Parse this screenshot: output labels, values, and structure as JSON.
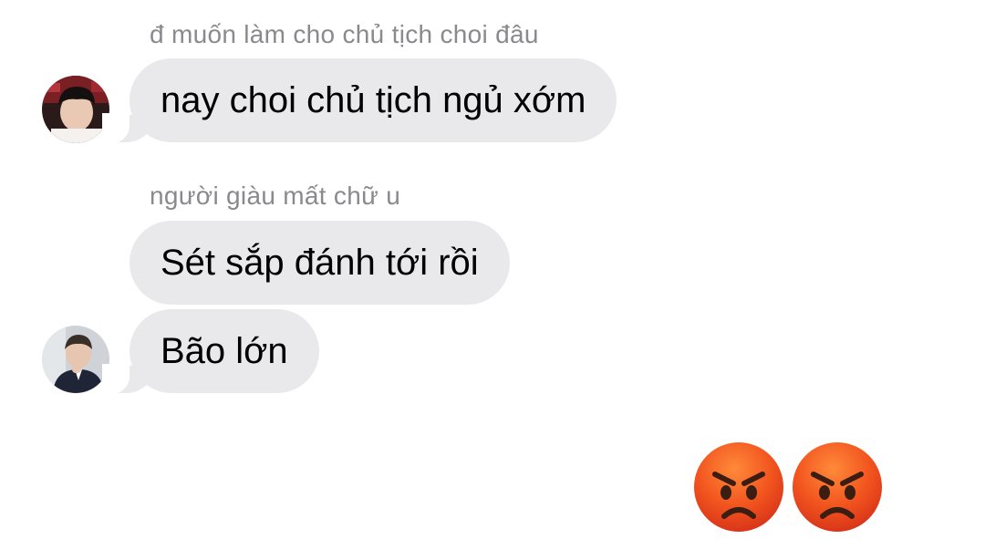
{
  "messages": [
    {
      "sender_name": "đ muốn làm cho chủ tịch choi đâu",
      "text": "nay choi chủ tịch ngủ xớm"
    },
    {
      "sender_name": "người giàu mất chữ u",
      "text": "Sét sắp đánh tới rồi"
    },
    {
      "sender_name": "",
      "text": "Bão lớn"
    }
  ],
  "reaction": {
    "emojis": [
      "😡",
      "😡"
    ],
    "icon": "angry-face-icon",
    "color": "#f2541e"
  },
  "colors": {
    "bubble": "#e9e9eb",
    "sender_name": "#8a8a8e",
    "background": "#ffffff"
  }
}
